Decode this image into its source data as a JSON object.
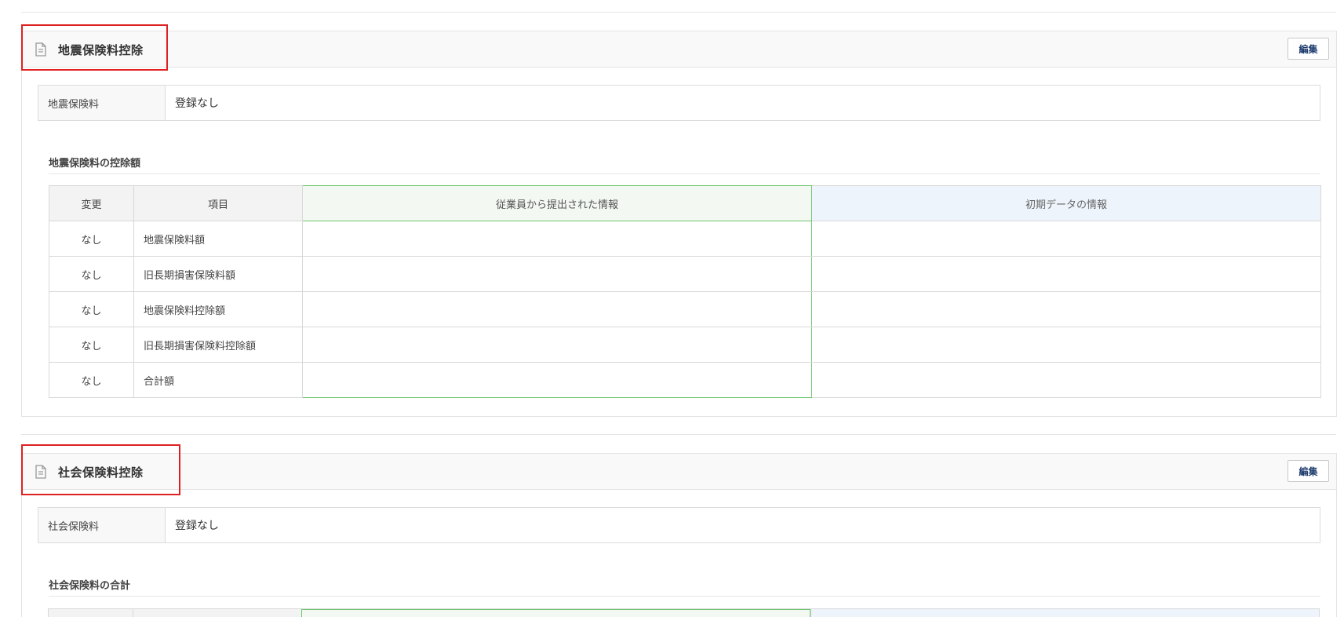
{
  "sections": [
    {
      "title": "地震保険料控除",
      "edit_label": "編集",
      "field_label": "地震保険料",
      "field_value": "登録なし",
      "subtitle": "地震保険料の控除額",
      "columns": [
        "変更",
        "項目",
        "従業員から提出された情報",
        "初期データの情報"
      ],
      "rows": [
        {
          "change": "なし",
          "item": "地震保険料額",
          "employee": "",
          "initial": ""
        },
        {
          "change": "なし",
          "item": "旧長期損害保険料額",
          "employee": "",
          "initial": ""
        },
        {
          "change": "なし",
          "item": "地震保険料控除額",
          "employee": "",
          "initial": ""
        },
        {
          "change": "なし",
          "item": "旧長期損害保険料控除額",
          "employee": "",
          "initial": ""
        },
        {
          "change": "なし",
          "item": "合計額",
          "employee": "",
          "initial": ""
        }
      ]
    },
    {
      "title": "社会保険料控除",
      "edit_label": "編集",
      "field_label": "社会保険料",
      "field_value": "登録なし",
      "subtitle": "社会保険料の合計"
    }
  ],
  "icons": {
    "section_icon": "document-icon"
  },
  "colors": {
    "highlight": "#e02020",
    "employee_column": "#6cc56c",
    "initial_column": "#edf4fb",
    "edit_text": "#1d3b6e"
  }
}
